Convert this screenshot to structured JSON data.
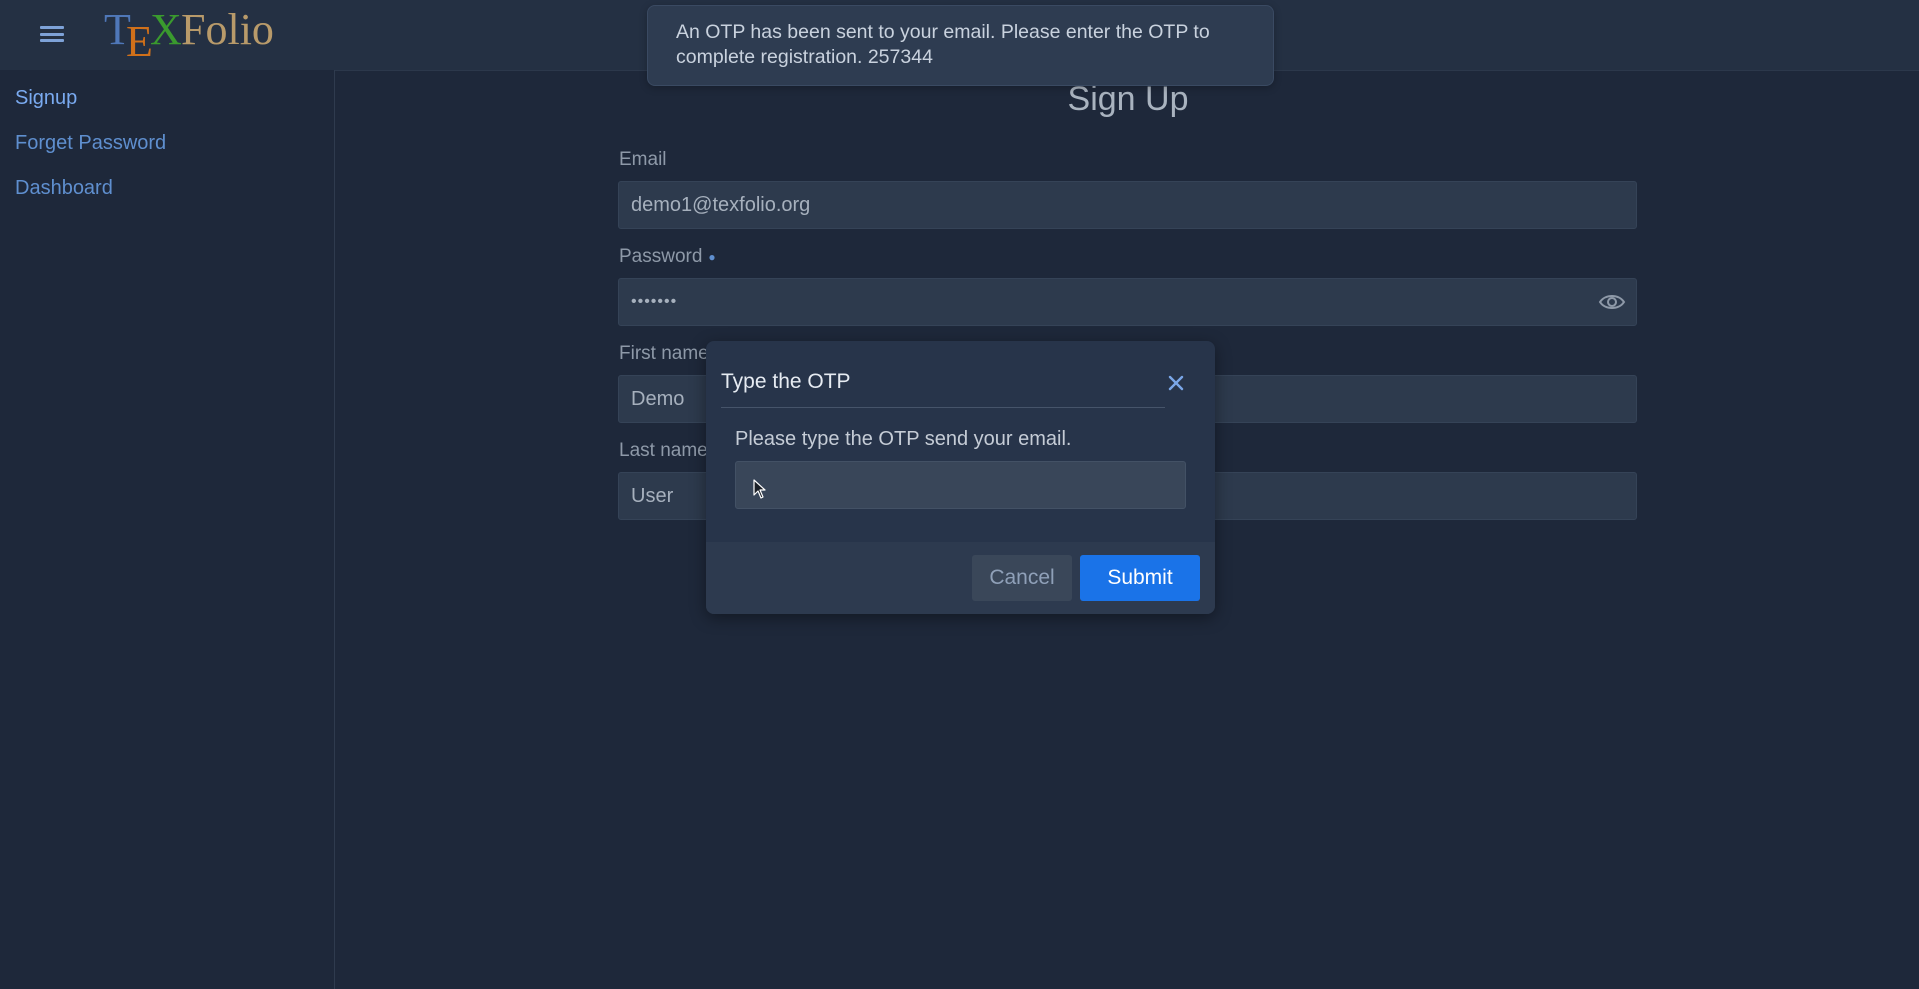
{
  "app": {
    "logo_text": "TEXFolio",
    "colors": {
      "background": "#1e283a",
      "header": "#243043",
      "link": "#5f8fcf",
      "accent": "#1a73e8",
      "logo_t": "#4f77b8",
      "logo_e": "#d0701a",
      "logo_x": "#3a9a2e",
      "logo_folio": "#b89a6a"
    }
  },
  "header": {
    "menu_icon": "hamburger-icon"
  },
  "sidebar": {
    "items": [
      {
        "label": "Signup",
        "active": true
      },
      {
        "label": "Forget Password",
        "active": false
      },
      {
        "label": "Dashboard",
        "active": false
      }
    ]
  },
  "toast": {
    "message": "An OTP has been sent to your email. Please enter the OTP to complete registration. 257344"
  },
  "form": {
    "title": "Sign Up",
    "email_label": "Email",
    "email_value": "demo1@texfolio.org",
    "password_label": "Password",
    "password_value": "•••••••",
    "password_icon": "eye-icon",
    "first_name_label": "First name",
    "first_name_value": "Demo",
    "last_name_label": "Last name",
    "last_name_value": "User"
  },
  "dialog": {
    "title": "Type the OTP",
    "close_icon": "close-icon",
    "message": "Please type the OTP send your email.",
    "otp_value": "",
    "cancel_label": "Cancel",
    "submit_label": "Submit"
  }
}
